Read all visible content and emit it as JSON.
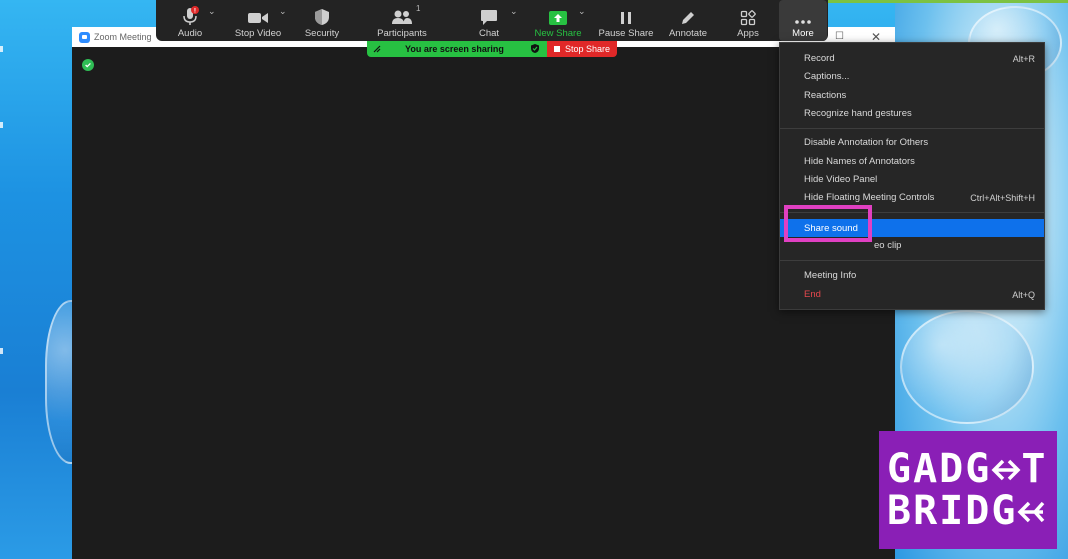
{
  "window": {
    "title": "Zoom Meeting"
  },
  "toolbar": {
    "audio": "Audio",
    "audio_badge": "!",
    "stop_video": "Stop Video",
    "security": "Security",
    "participants": "Participants",
    "participants_count": "1",
    "chat": "Chat",
    "new_share": "New Share",
    "pause_share": "Pause Share",
    "annotate": "Annotate",
    "apps": "Apps",
    "more": "More"
  },
  "share_bar": {
    "status": "You are screen sharing",
    "stop": "Stop Share"
  },
  "menu": {
    "record": {
      "label": "Record",
      "shortcut": "Alt+R"
    },
    "captions": {
      "label": "Captions..."
    },
    "reactions": {
      "label": "Reactions"
    },
    "hand_gestures": {
      "label": "Recognize hand gestures"
    },
    "disable_annotation": {
      "label": "Disable Annotation for Others"
    },
    "hide_annotators": {
      "label": "Hide Names of Annotators"
    },
    "hide_video_panel": {
      "label": "Hide Video Panel"
    },
    "hide_floating": {
      "label": "Hide Floating Meeting Controls",
      "shortcut": "Ctrl+Alt+Shift+H"
    },
    "share_sound": {
      "label": "Share sound"
    },
    "video_clip": {
      "label": "eo clip"
    },
    "meeting_info": {
      "label": "Meeting Info"
    },
    "end": {
      "label": "End",
      "shortcut": "Alt+Q"
    }
  },
  "logo": {
    "line1": "GADG",
    "line2": "BRIDG"
  },
  "colors": {
    "accent": "#0e71eb",
    "share_green": "#27c142",
    "stop_red": "#e02828",
    "end_red": "#e5484d",
    "highlight_box": "#e040c2",
    "logo_bg": "#8a1fb6"
  }
}
